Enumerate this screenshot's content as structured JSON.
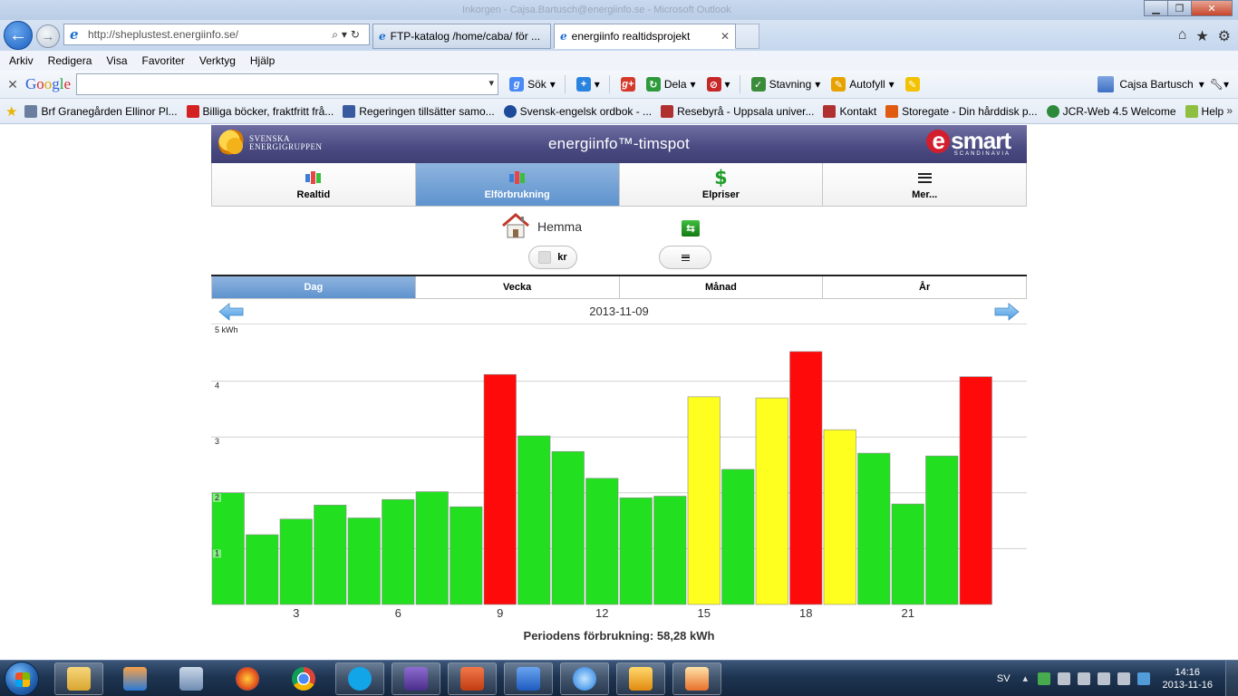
{
  "window": {
    "title_ghost": "Inkorgen - Cajsa.Bartusch@energiinfo.se - Microsoft Outlook"
  },
  "browser": {
    "url": "http://sheplustest.energiinfo.se/",
    "tabs": [
      {
        "label": "FTP-katalog /home/caba/ för ...",
        "active": false
      },
      {
        "label": "energiinfo realtidsprojekt",
        "active": true
      }
    ],
    "menu": [
      "Arkiv",
      "Redigera",
      "Visa",
      "Favoriter",
      "Verktyg",
      "Hjälp"
    ],
    "google_toolbar": {
      "logo": "Google",
      "search_value": "",
      "items": [
        "Sök",
        "Dela",
        "Stavning",
        "Autofyll"
      ],
      "user": "Cajsa Bartusch"
    },
    "favorites": [
      "Brf Granegården Ellinor Pl...",
      "Billiga böcker, fraktfritt frå...",
      "Regeringen tillsätter samo...",
      "Svensk-engelsk ordbok - ...",
      "Resebyrå - Uppsala univer...",
      "Kontakt",
      "Storegate - Din hårddisk p...",
      "JCR-Web 4.5 Welcome",
      "Help"
    ]
  },
  "app": {
    "brand_left_line1": "SVENSKA",
    "brand_left_line2": "ENERGIGRUPPEN",
    "title": "energiinfo™-timspot",
    "brand_right": "smart",
    "brand_right_e": "e",
    "brand_right_sub": "SCANDINAVIA",
    "nav": [
      {
        "label": "Realtid",
        "icon": "bar-chart-icon",
        "active": false
      },
      {
        "label": "Elförbrukning",
        "icon": "bar-chart-icon",
        "active": true
      },
      {
        "label": "Elpriser",
        "icon": "dollar-icon",
        "active": false
      },
      {
        "label": "Mer...",
        "icon": "menu-icon",
        "active": false
      }
    ],
    "location": "Hemma",
    "currency_toggle": "kr",
    "periods": [
      {
        "label": "Dag",
        "active": true
      },
      {
        "label": "Vecka",
        "active": false
      },
      {
        "label": "Månad",
        "active": false
      },
      {
        "label": "År",
        "active": false
      }
    ],
    "date": "2013-11-09",
    "total_label": "Periodens förbrukning: 58,28 kWh"
  },
  "chart_data": {
    "type": "bar",
    "ylabel": "5 kWh",
    "ylim": [
      0,
      5
    ],
    "yticks": [
      1,
      2,
      3,
      4
    ],
    "grid": true,
    "x": [
      1,
      2,
      3,
      4,
      5,
      6,
      7,
      8,
      9,
      10,
      11,
      12,
      13,
      14,
      15,
      16,
      17,
      18,
      19,
      20,
      21,
      22,
      23,
      24
    ],
    "xtick_labels": [
      "3",
      "6",
      "9",
      "12",
      "15",
      "18",
      "21"
    ],
    "xtick_positions": [
      3,
      6,
      9,
      12,
      15,
      18,
      21
    ],
    "values": [
      2.0,
      1.25,
      1.53,
      1.78,
      1.55,
      1.88,
      2.02,
      1.75,
      4.12,
      3.02,
      2.74,
      2.26,
      1.91,
      1.94,
      3.72,
      2.42,
      3.7,
      4.53,
      3.13,
      2.71,
      1.8,
      2.66,
      4.08,
      0
    ],
    "colors": [
      "green",
      "green",
      "green",
      "green",
      "green",
      "green",
      "green",
      "green",
      "red",
      "green",
      "green",
      "green",
      "green",
      "green",
      "yellow",
      "green",
      "yellow",
      "red",
      "yellow",
      "green",
      "green",
      "green",
      "red",
      "none"
    ],
    "color_map": {
      "green": "#22e01f",
      "yellow": "#ffff1f",
      "red": "#ff0a0a"
    }
  },
  "taskbar": {
    "apps": [
      "explorer-icon",
      "media-player-icon",
      "network-icon",
      "firefox-icon",
      "chrome-icon",
      "skype-icon",
      "vm-icon",
      "powerpoint-icon",
      "word-icon",
      "ie-icon",
      "outlook-icon",
      "paint-icon"
    ],
    "lang": "SV",
    "time": "14:16",
    "date": "2013-11-16"
  }
}
